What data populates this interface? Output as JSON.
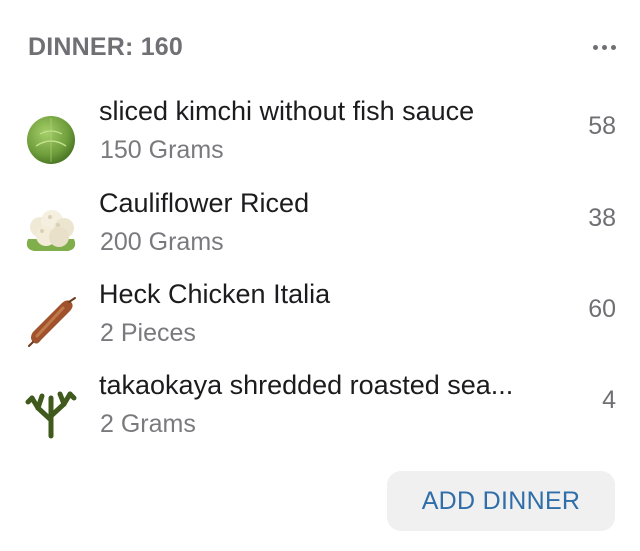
{
  "header": {
    "title": "DINNER: 160"
  },
  "items": [
    {
      "name": "sliced kimchi without fish sauce",
      "amount": "150 Grams",
      "calories": "58",
      "icon": "cabbage-icon"
    },
    {
      "name": "Cauliflower Riced",
      "amount": "200 Grams",
      "calories": "38",
      "icon": "cauliflower-icon"
    },
    {
      "name": "Heck Chicken Italia",
      "amount": "2 Pieces",
      "calories": "60",
      "icon": "sausage-icon"
    },
    {
      "name": "takaokaya shredded roasted sea...",
      "amount": "2 Grams",
      "calories": "4",
      "icon": "seaweed-icon"
    }
  ],
  "actions": {
    "add_label": "ADD DINNER"
  },
  "colors": {
    "header_text": "#6f6f74",
    "primary_text": "#1c1c1e",
    "secondary_text": "#7a7a7e",
    "accent": "#2f6ea8",
    "button_bg": "#f0f0f1"
  }
}
